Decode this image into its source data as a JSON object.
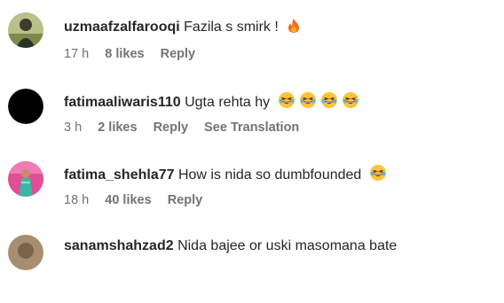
{
  "comments": [
    {
      "username": "uzmaafzalfarooqi",
      "text": "Fazila s smirk !",
      "emojis": [
        "fire"
      ],
      "time": "17 h",
      "likes": "8 likes",
      "reply": "Reply",
      "avatar_colors": [
        "#9aa66a",
        "#2e3a2a"
      ]
    },
    {
      "username": "fatimaaliwaris110",
      "text": "Ugta rehta hy",
      "emojis": [
        "laughing",
        "laughing",
        "laughing",
        "laughing"
      ],
      "time": "3 h",
      "likes": "2 likes",
      "reply": "Reply",
      "translation": "See Translation",
      "avatar_colors": [
        "#000000",
        "#000000"
      ]
    },
    {
      "username": "fatima_shehla77",
      "text": "How is nida so dumbfounded",
      "emojis": [
        "laughing"
      ],
      "time": "18 h",
      "likes": "40 likes",
      "reply": "Reply",
      "avatar_colors": [
        "#e85aa0",
        "#3fb8a8"
      ]
    },
    {
      "username": "sanamshahzad2",
      "text": "Nida bajee or uski masomana bate",
      "emojis": [],
      "avatar_colors": [
        "#b8a080",
        "#6a5440"
      ]
    }
  ]
}
